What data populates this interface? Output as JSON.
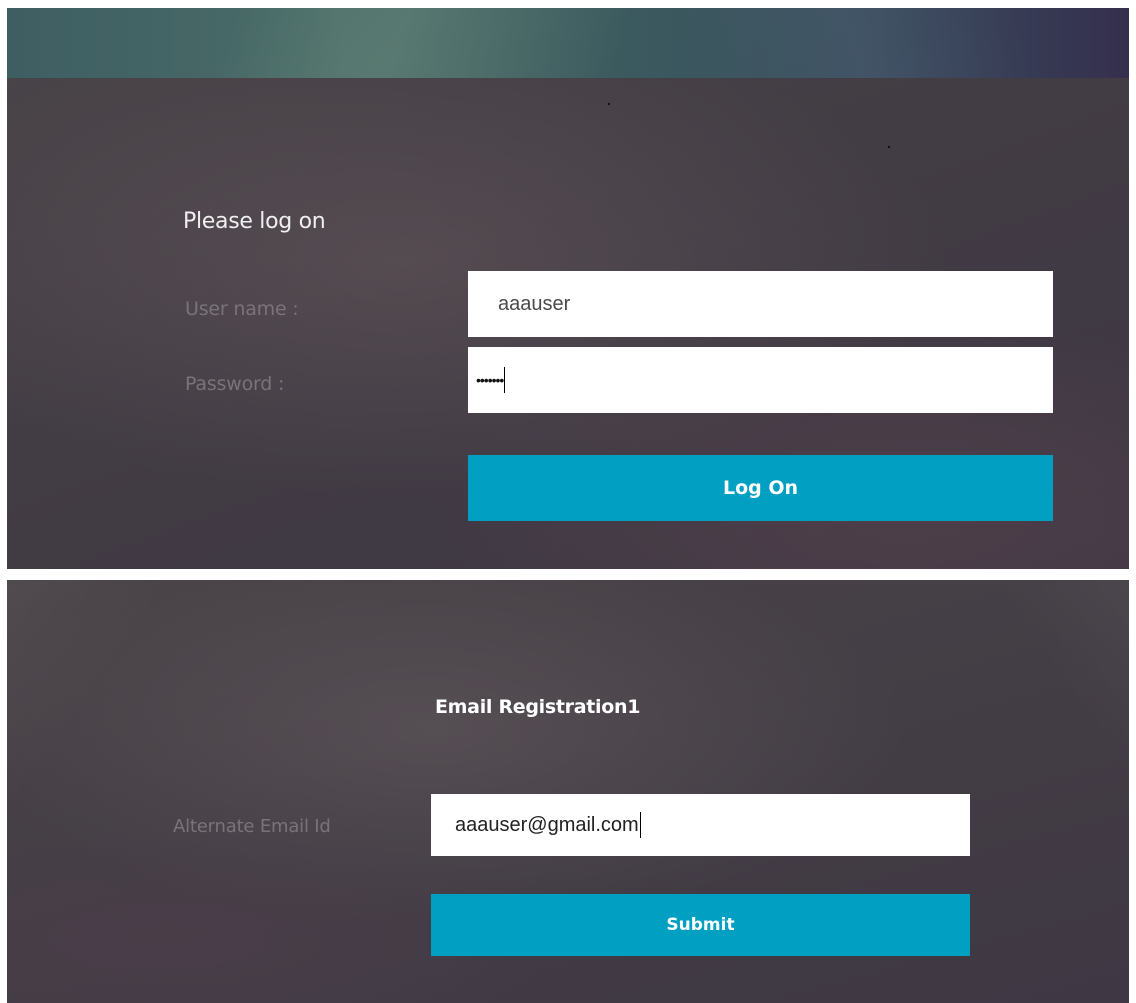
{
  "logon": {
    "title": "Please log on",
    "username_label": "User name :",
    "username_value": "aaauser",
    "password_label": "Password :",
    "password_masked": "•••••••",
    "submit_label": "Log On"
  },
  "registration": {
    "title": "Email Registration1",
    "email_label": "Alternate Email Id",
    "email_value": "aaauser@gmail.com",
    "submit_label": "Submit"
  },
  "colors": {
    "button": "#01a0c2",
    "field_bg": "#ffffff",
    "label": "#7a7378"
  }
}
